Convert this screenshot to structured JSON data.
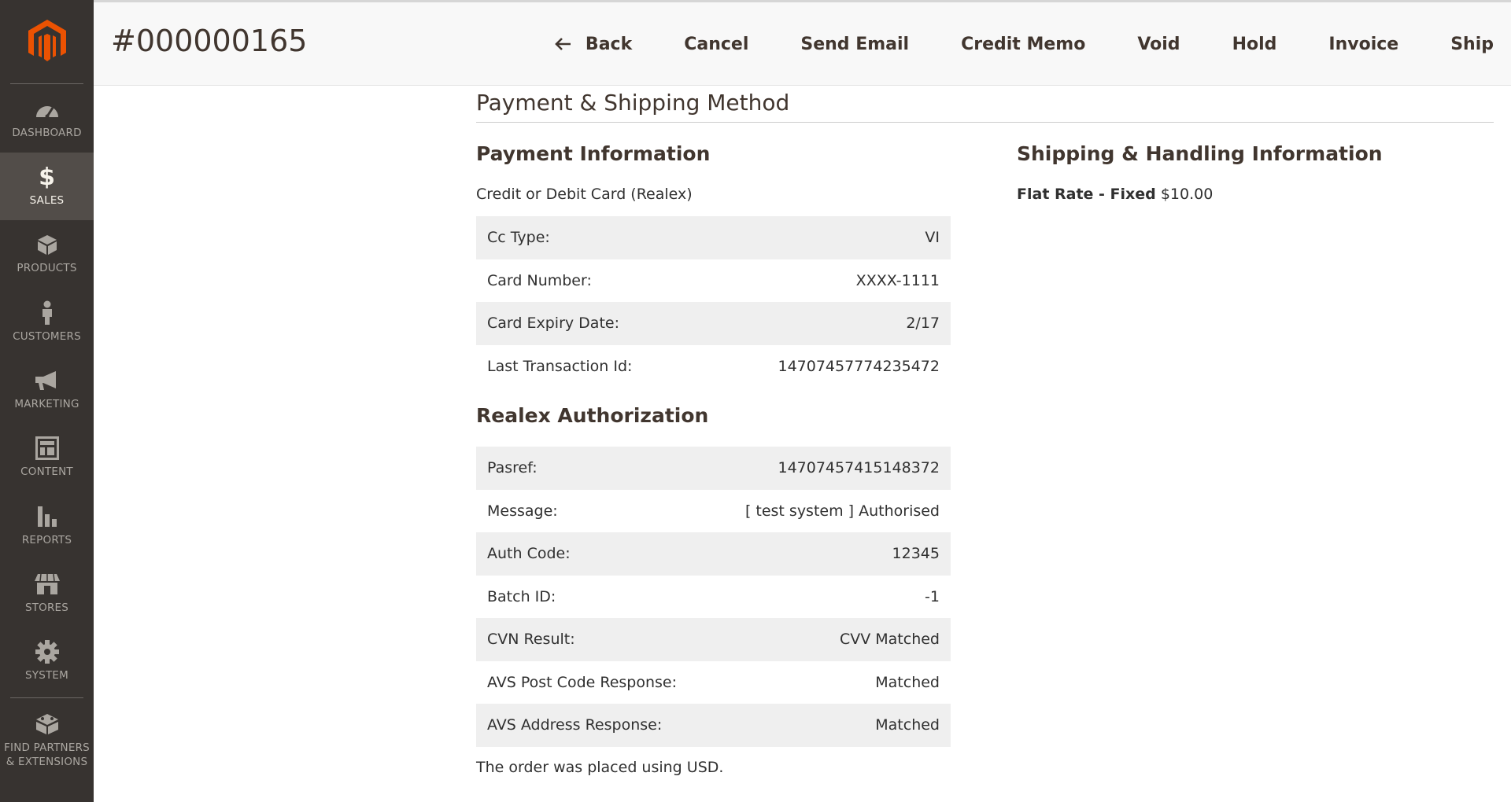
{
  "sidebar": {
    "items": [
      {
        "label": "DASHBOARD",
        "icon": "dashboard-icon"
      },
      {
        "label": "SALES",
        "icon": "dollar-icon"
      },
      {
        "label": "PRODUCTS",
        "icon": "box-icon"
      },
      {
        "label": "CUSTOMERS",
        "icon": "person-icon"
      },
      {
        "label": "MARKETING",
        "icon": "megaphone-icon"
      },
      {
        "label": "CONTENT",
        "icon": "layout-icon"
      },
      {
        "label": "REPORTS",
        "icon": "bar-chart-icon"
      },
      {
        "label": "STORES",
        "icon": "storefront-icon"
      },
      {
        "label": "SYSTEM",
        "icon": "gear-icon"
      },
      {
        "label": "FIND PARTNERS & EXTENSIONS",
        "icon": "blocks-icon"
      }
    ],
    "active": "SALES"
  },
  "header": {
    "title": "#000000165",
    "actions": {
      "back": "Back",
      "cancel": "Cancel",
      "send_email": "Send Email",
      "credit_memo": "Credit Memo",
      "void": "Void",
      "hold": "Hold",
      "invoice": "Invoice",
      "ship": "Ship"
    }
  },
  "main": {
    "section_title": "Payment & Shipping Method",
    "payment": {
      "title": "Payment Information",
      "method": "Credit or Debit Card (Realex)",
      "rows": [
        {
          "label": "Cc Type:",
          "value": "VI"
        },
        {
          "label": "Card Number:",
          "value": "XXXX-1111"
        },
        {
          "label": "Card Expiry Date:",
          "value": "2/17"
        },
        {
          "label": "Last Transaction Id:",
          "value": "14707457774235472"
        }
      ]
    },
    "realex": {
      "title": "Realex Authorization",
      "rows": [
        {
          "label": "Pasref:",
          "value": "14707457415148372"
        },
        {
          "label": "Message:",
          "value": "[ test system ] Authorised"
        },
        {
          "label": "Auth Code:",
          "value": "12345"
        },
        {
          "label": "Batch ID:",
          "value": "-1"
        },
        {
          "label": "CVN Result:",
          "value": "CVV Matched"
        },
        {
          "label": "AVS Post Code Response:",
          "value": "Matched"
        },
        {
          "label": "AVS Address Response:",
          "value": "Matched"
        }
      ],
      "footer": "The order was placed using USD."
    },
    "shipping": {
      "title": "Shipping & Handling Information",
      "method_label": "Flat Rate - Fixed",
      "price": "$10.00"
    }
  },
  "colors": {
    "sidebar_bg": "#373330",
    "sidebar_active": "#524d49",
    "logo_orange": "#eb5202",
    "header_bg": "#f8f8f8"
  }
}
